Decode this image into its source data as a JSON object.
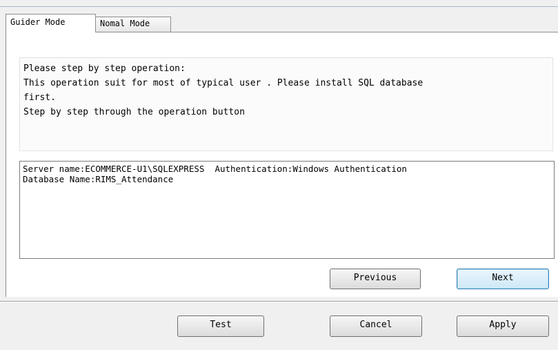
{
  "tabs": [
    {
      "label": "Guider Mode",
      "active": true
    },
    {
      "label": "Nomal Mode",
      "active": false
    }
  ],
  "description": {
    "lines": [
      "Please step by step operation:",
      "This  operation suit for most of  typical user . Please  install SQL database",
      "first.",
      "Step by step through the operation button"
    ]
  },
  "info": {
    "lines": [
      "Server name:ECOMMERCE-U1\\SQLEXPRESS  Authentication:Windows Authentication",
      "Database Name:RIMS_Attendance"
    ]
  },
  "wizard_buttons": {
    "previous": "Previous",
    "next": "Next"
  },
  "dialog_buttons": {
    "test": "Test",
    "cancel": "Cancel",
    "apply": "Apply"
  },
  "colors": {
    "window_bg": "#f0f0f0",
    "panel_bg": "#ffffff",
    "focus_border": "#3c7fb1"
  }
}
